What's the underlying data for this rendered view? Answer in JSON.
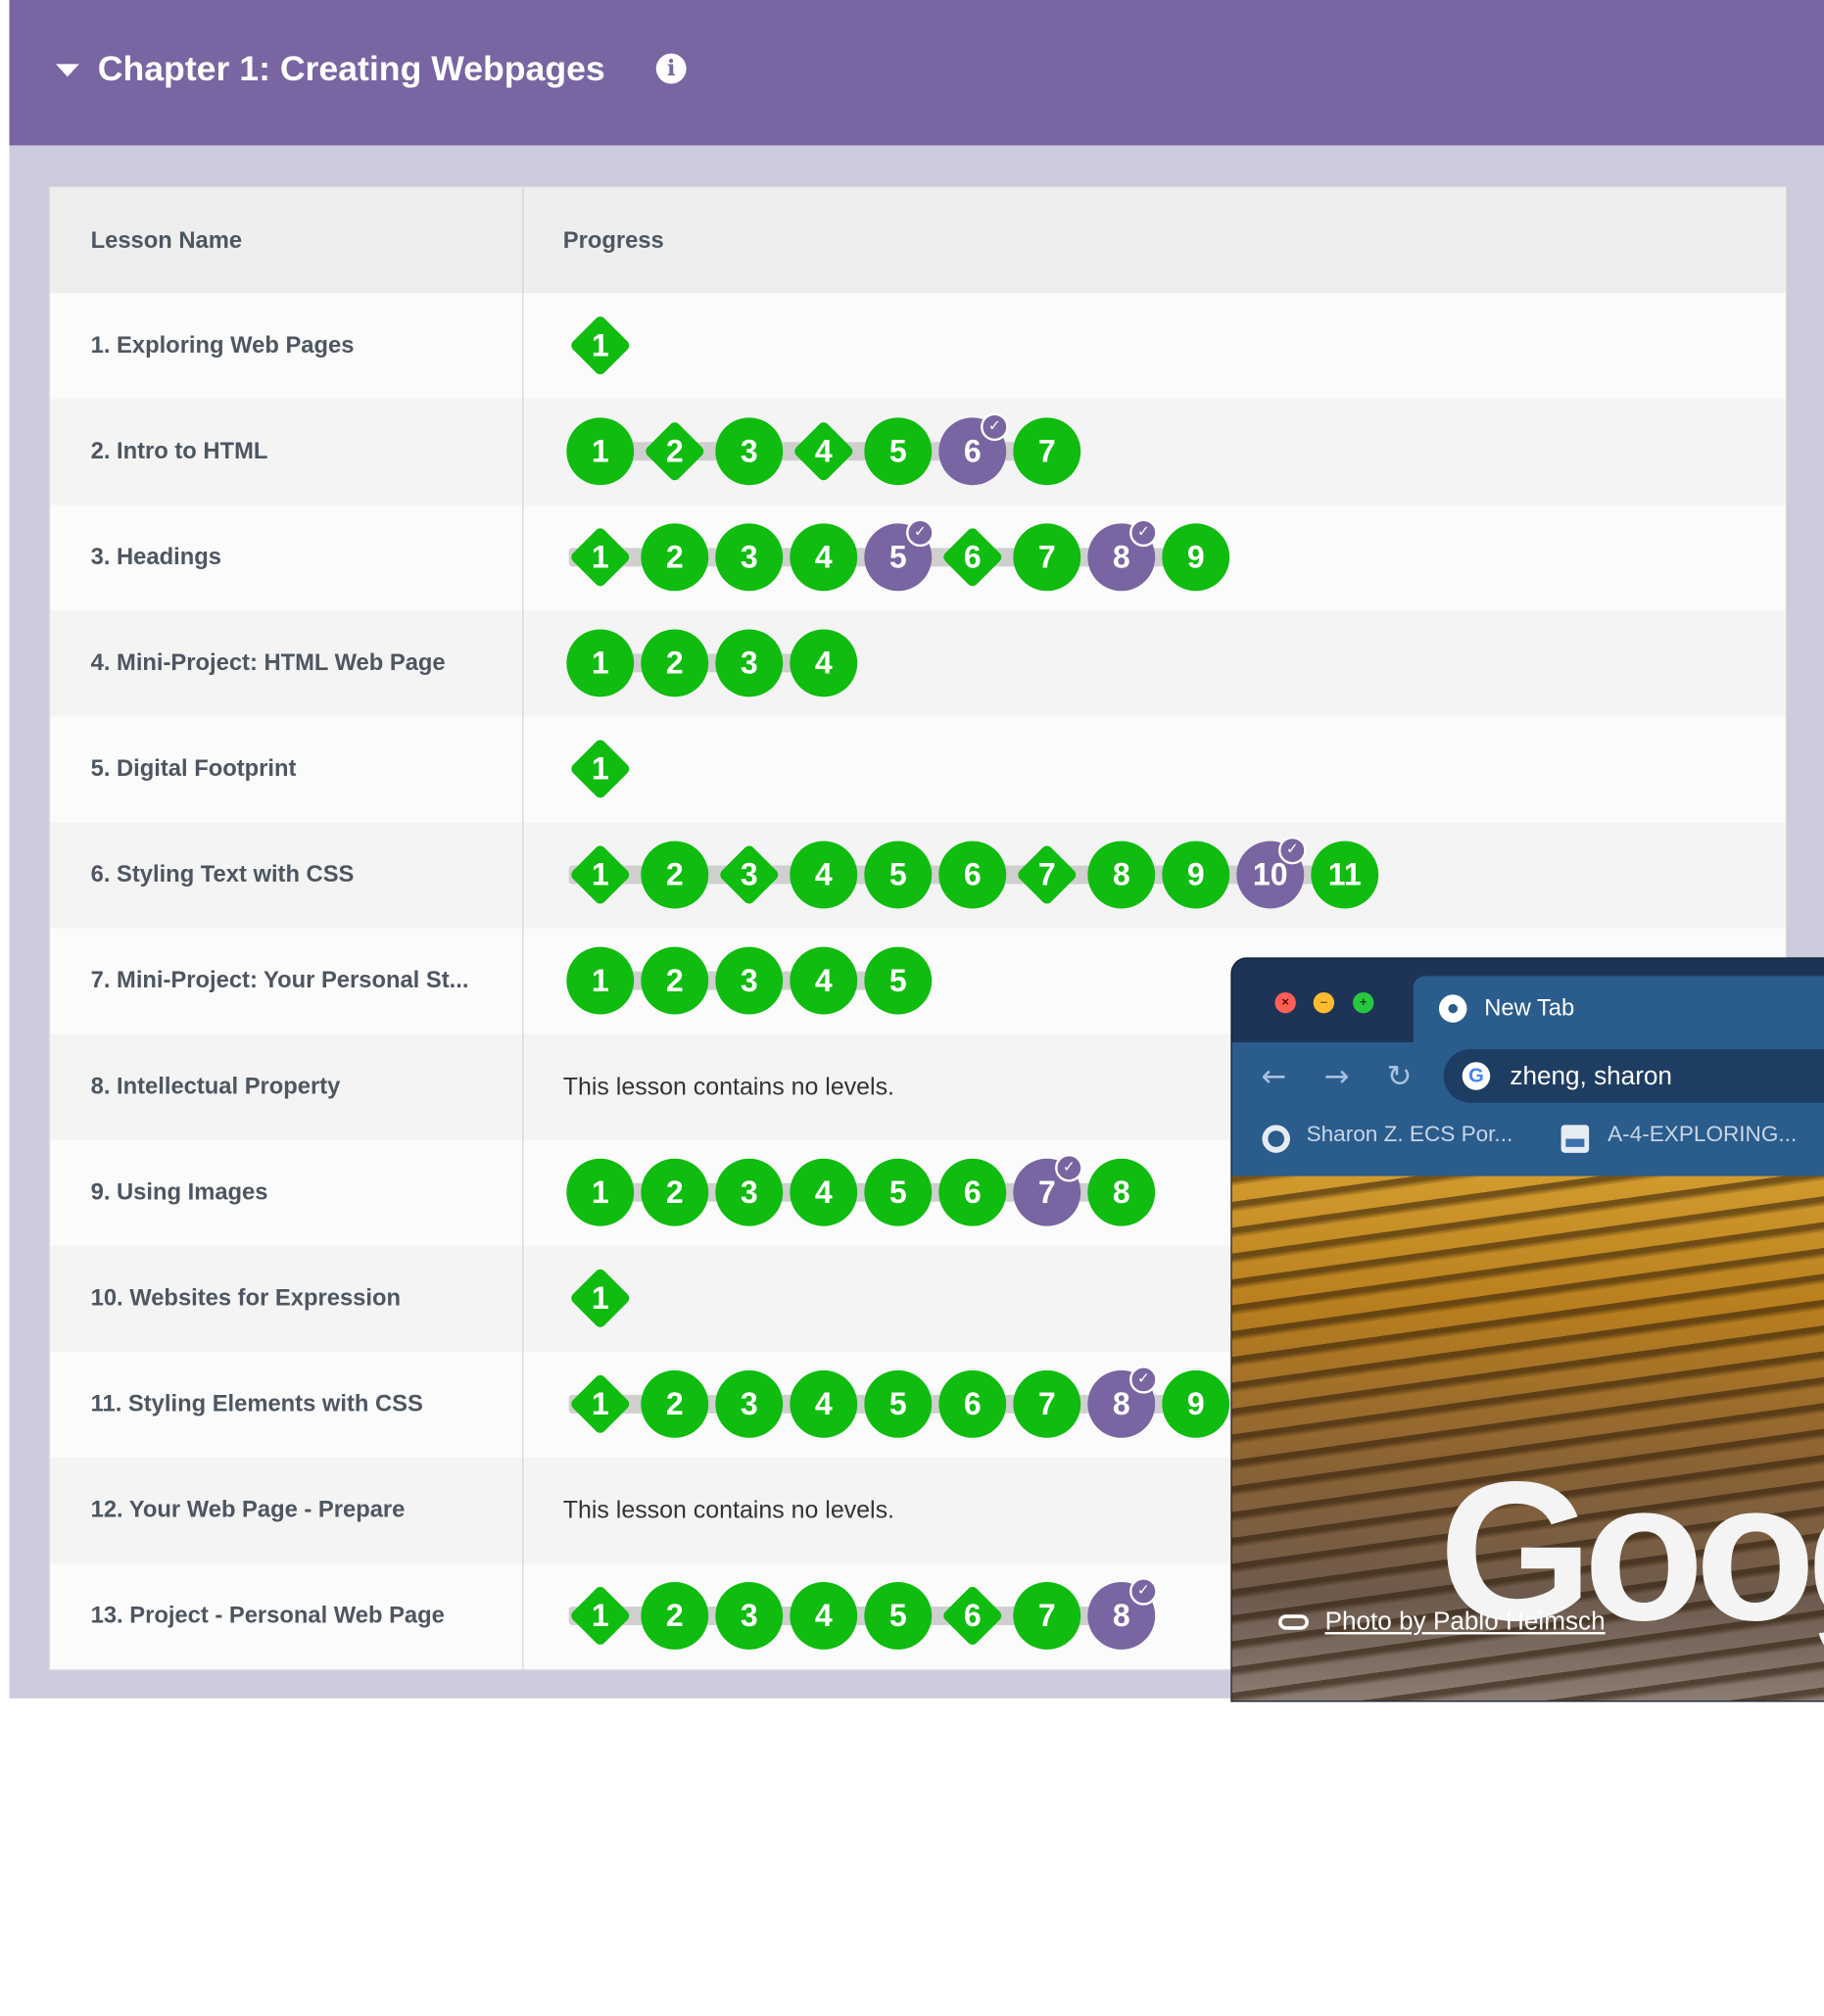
{
  "header": {
    "chapter_title": "Chapter 1: Creating Webpages",
    "info_icon": "i"
  },
  "table": {
    "columns": [
      "Lesson Name",
      "Progress"
    ],
    "no_levels_text": "This lesson contains no levels.",
    "rows": [
      {
        "name": "1. Exploring Web Pages",
        "levels": [
          {
            "n": "1",
            "shape": "diamond",
            "status": "complete"
          }
        ]
      },
      {
        "name": "2. Intro to HTML",
        "levels": [
          {
            "n": "1",
            "shape": "circle",
            "status": "complete"
          },
          {
            "n": "2",
            "shape": "diamond",
            "status": "complete"
          },
          {
            "n": "3",
            "shape": "circle",
            "status": "complete"
          },
          {
            "n": "4",
            "shape": "diamond",
            "status": "complete"
          },
          {
            "n": "5",
            "shape": "circle",
            "status": "complete"
          },
          {
            "n": "6",
            "shape": "circle",
            "status": "submitted"
          },
          {
            "n": "7",
            "shape": "circle",
            "status": "complete"
          }
        ]
      },
      {
        "name": "3. Headings",
        "levels": [
          {
            "n": "1",
            "shape": "diamond",
            "status": "complete"
          },
          {
            "n": "2",
            "shape": "circle",
            "status": "complete"
          },
          {
            "n": "3",
            "shape": "circle",
            "status": "complete"
          },
          {
            "n": "4",
            "shape": "circle",
            "status": "complete"
          },
          {
            "n": "5",
            "shape": "circle",
            "status": "submitted"
          },
          {
            "n": "6",
            "shape": "diamond",
            "status": "complete"
          },
          {
            "n": "7",
            "shape": "circle",
            "status": "complete"
          },
          {
            "n": "8",
            "shape": "circle",
            "status": "submitted"
          },
          {
            "n": "9",
            "shape": "circle",
            "status": "complete"
          }
        ]
      },
      {
        "name": "4. Mini-Project: HTML Web Page",
        "levels": [
          {
            "n": "1",
            "shape": "circle",
            "status": "complete"
          },
          {
            "n": "2",
            "shape": "circle",
            "status": "complete"
          },
          {
            "n": "3",
            "shape": "circle",
            "status": "complete"
          },
          {
            "n": "4",
            "shape": "circle",
            "status": "complete"
          }
        ]
      },
      {
        "name": "5. Digital Footprint",
        "levels": [
          {
            "n": "1",
            "shape": "diamond",
            "status": "complete"
          }
        ]
      },
      {
        "name": "6. Styling Text with CSS",
        "levels": [
          {
            "n": "1",
            "shape": "diamond",
            "status": "complete"
          },
          {
            "n": "2",
            "shape": "circle",
            "status": "complete"
          },
          {
            "n": "3",
            "shape": "diamond",
            "status": "complete"
          },
          {
            "n": "4",
            "shape": "circle",
            "status": "complete"
          },
          {
            "n": "5",
            "shape": "circle",
            "status": "complete"
          },
          {
            "n": "6",
            "shape": "circle",
            "status": "complete"
          },
          {
            "n": "7",
            "shape": "diamond",
            "status": "complete"
          },
          {
            "n": "8",
            "shape": "circle",
            "status": "complete"
          },
          {
            "n": "9",
            "shape": "circle",
            "status": "complete"
          },
          {
            "n": "10",
            "shape": "circle",
            "status": "submitted"
          },
          {
            "n": "11",
            "shape": "circle",
            "status": "complete"
          }
        ]
      },
      {
        "name": "7. Mini-Project: Your Personal St...",
        "levels": [
          {
            "n": "1",
            "shape": "circle",
            "status": "complete"
          },
          {
            "n": "2",
            "shape": "circle",
            "status": "complete"
          },
          {
            "n": "3",
            "shape": "circle",
            "status": "complete"
          },
          {
            "n": "4",
            "shape": "circle",
            "status": "complete"
          },
          {
            "n": "5",
            "shape": "circle",
            "status": "complete"
          }
        ]
      },
      {
        "name": "8. Intellectual Property",
        "levels": []
      },
      {
        "name": "9. Using Images",
        "levels": [
          {
            "n": "1",
            "shape": "circle",
            "status": "complete"
          },
          {
            "n": "2",
            "shape": "circle",
            "status": "complete"
          },
          {
            "n": "3",
            "shape": "circle",
            "status": "complete"
          },
          {
            "n": "4",
            "shape": "circle",
            "status": "complete"
          },
          {
            "n": "5",
            "shape": "circle",
            "status": "complete"
          },
          {
            "n": "6",
            "shape": "circle",
            "status": "complete"
          },
          {
            "n": "7",
            "shape": "circle",
            "status": "submitted"
          },
          {
            "n": "8",
            "shape": "circle",
            "status": "complete"
          }
        ]
      },
      {
        "name": "10. Websites for Expression",
        "levels": [
          {
            "n": "1",
            "shape": "diamond",
            "status": "complete"
          }
        ]
      },
      {
        "name": "11. Styling Elements with CSS",
        "levels": [
          {
            "n": "1",
            "shape": "diamond",
            "status": "complete"
          },
          {
            "n": "2",
            "shape": "circle",
            "status": "complete"
          },
          {
            "n": "3",
            "shape": "circle",
            "status": "complete"
          },
          {
            "n": "4",
            "shape": "circle",
            "status": "complete"
          },
          {
            "n": "5",
            "shape": "circle",
            "status": "complete"
          },
          {
            "n": "6",
            "shape": "circle",
            "status": "complete"
          },
          {
            "n": "7",
            "shape": "circle",
            "status": "complete"
          },
          {
            "n": "8",
            "shape": "circle",
            "status": "submitted"
          },
          {
            "n": "9",
            "shape": "circle",
            "status": "complete"
          }
        ]
      },
      {
        "name": "12. Your Web Page - Prepare",
        "levels": []
      },
      {
        "name": "13. Project - Personal Web Page",
        "levels": [
          {
            "n": "1",
            "shape": "diamond",
            "status": "complete"
          },
          {
            "n": "2",
            "shape": "circle",
            "status": "complete"
          },
          {
            "n": "3",
            "shape": "circle",
            "status": "complete"
          },
          {
            "n": "4",
            "shape": "circle",
            "status": "complete"
          },
          {
            "n": "5",
            "shape": "circle",
            "status": "complete"
          },
          {
            "n": "6",
            "shape": "diamond",
            "status": "complete"
          },
          {
            "n": "7",
            "shape": "circle",
            "status": "complete"
          },
          {
            "n": "8",
            "shape": "circle",
            "status": "submitted"
          }
        ]
      }
    ]
  },
  "colors": {
    "header": "#7865a1",
    "complete": "#0fbc0f",
    "submitted": "#7865a1",
    "page_bg": "#cecbde"
  },
  "browser": {
    "tab_title": "New Tab",
    "omnibox_text": "zheng, sharon",
    "google_letter": "G",
    "back_glyph": "←",
    "forward_glyph": "→",
    "reload_glyph": "↻",
    "bookmarks": [
      {
        "label": "Sharon Z. ECS Por...",
        "icon": "globe-icon"
      },
      {
        "label": "A-4-EXPLORING...",
        "icon": "doc-icon"
      }
    ],
    "google_logo": "Goog",
    "photo_credit": "Photo by Pablo Heimsch"
  }
}
